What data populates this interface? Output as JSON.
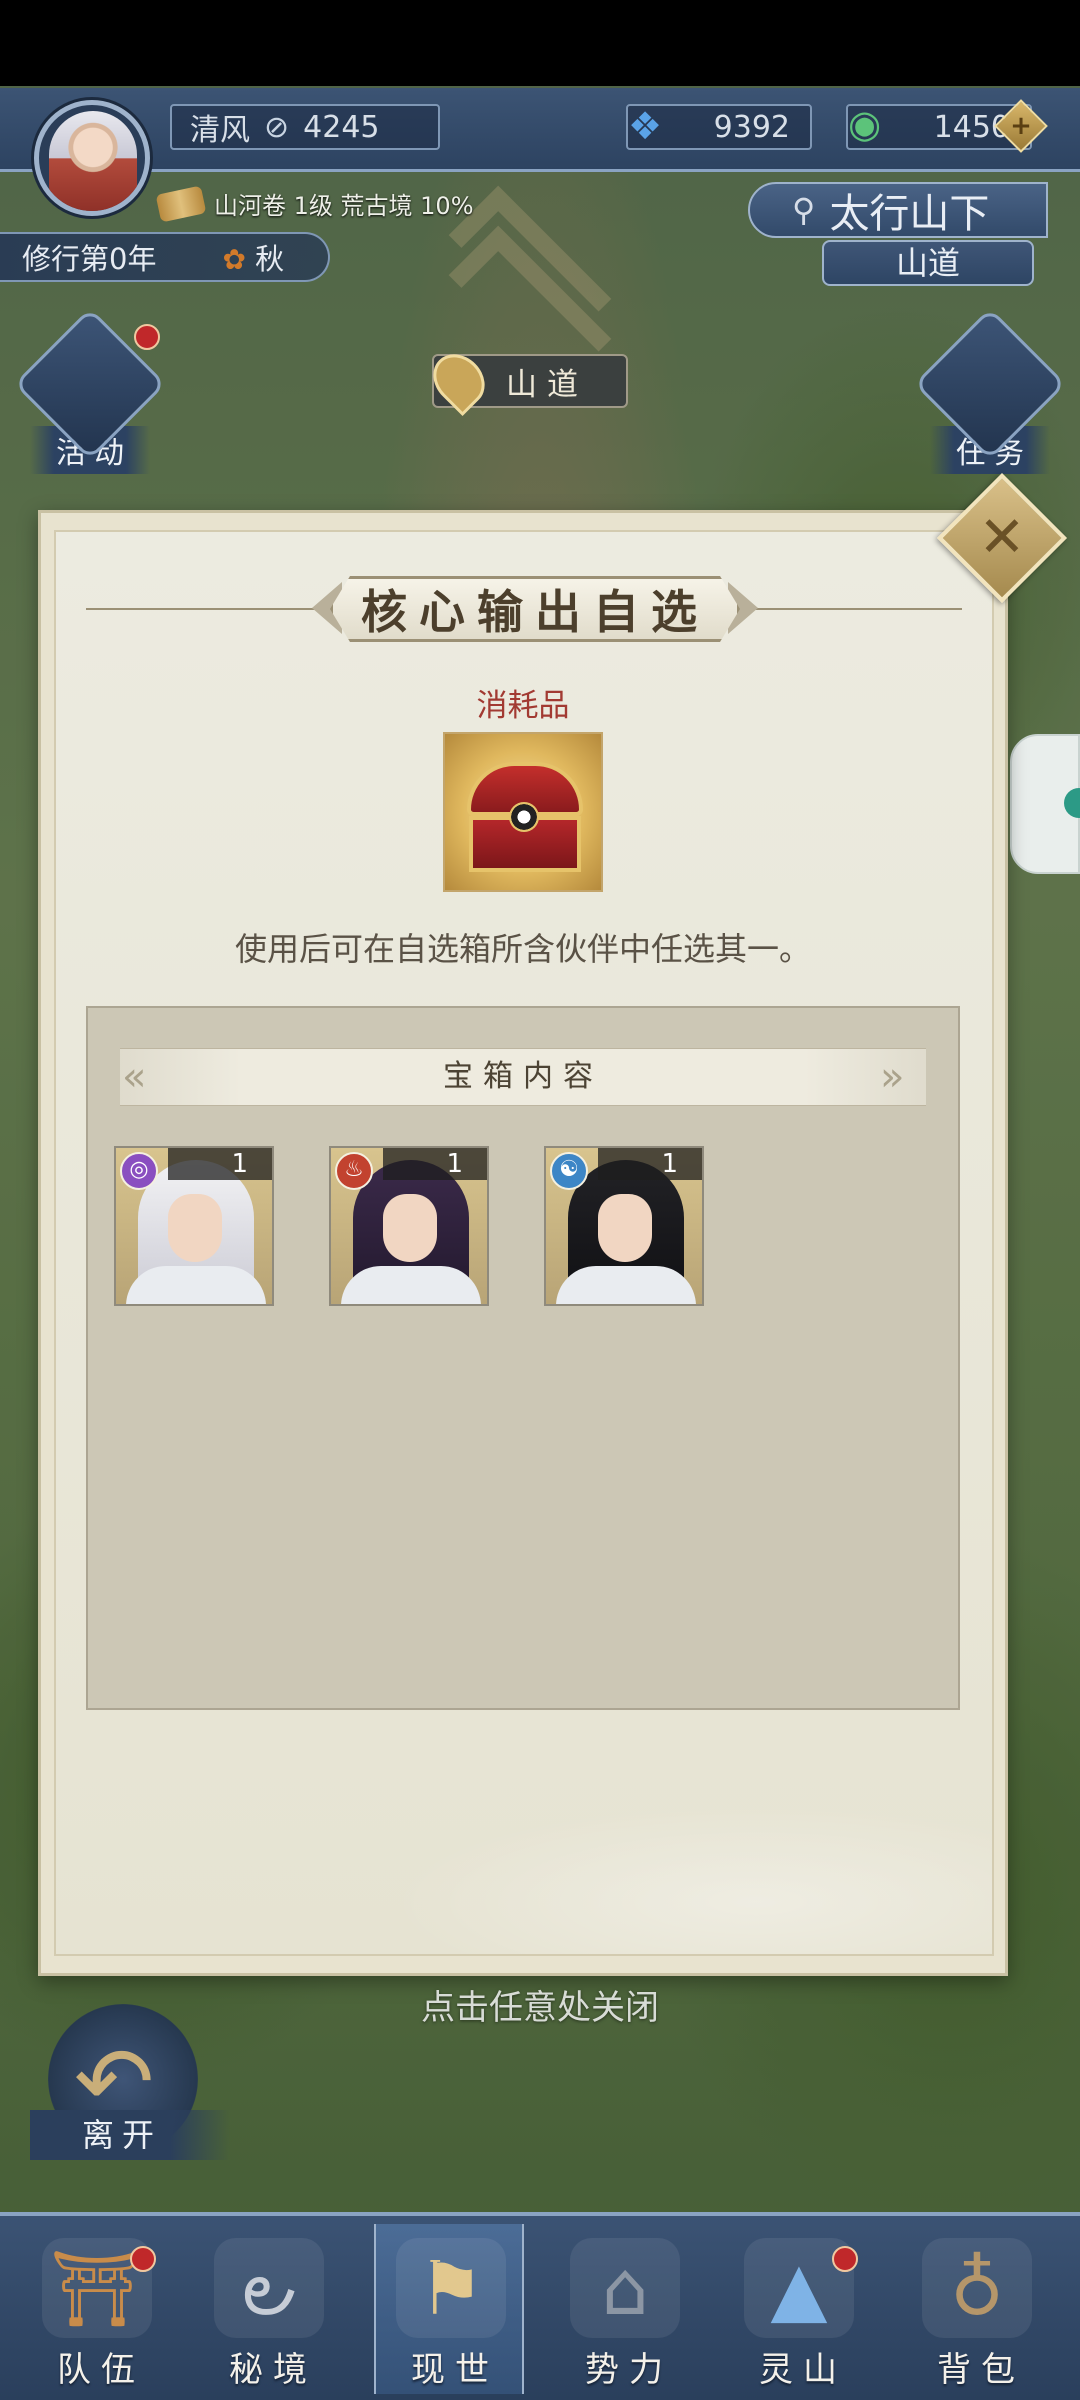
{
  "hud": {
    "player_name": "清风",
    "power_value": "4245",
    "currency_1": "9392",
    "currency_2": "1450",
    "realm_text": "山河卷 1级 荒古境 10%",
    "cultivation_year": "修行第0年",
    "season": "秋",
    "location_title": "太行山下",
    "location_sub": "山道"
  },
  "map": {
    "road_sign": "山道"
  },
  "side_buttons": {
    "activity": "活动",
    "task": "任务"
  },
  "modal": {
    "title": "核心输出自选",
    "category": "消耗品",
    "description": "使用后可在自选箱所含伙伴中任选其一。",
    "contents_header": "宝箱内容",
    "close_hint": "点击任意处关闭",
    "heroes": [
      {
        "count": "1",
        "element_icon": "vortex-element-icon",
        "element_color": "#8a4fc0"
      },
      {
        "count": "1",
        "element_icon": "fire-element-icon",
        "element_color": "#c2422f"
      },
      {
        "count": "1",
        "element_icon": "water-element-icon",
        "element_color": "#3d86c6"
      }
    ]
  },
  "leave_button": "离开",
  "bottom_nav": [
    "队伍",
    "秘境",
    "现世",
    "势力",
    "灵山",
    "背包"
  ],
  "colors": {
    "hud_blue": "#2d4361",
    "modal_paper": "#e6e3d2",
    "category_red": "#a23a32",
    "gold_accent": "#d9c089"
  }
}
